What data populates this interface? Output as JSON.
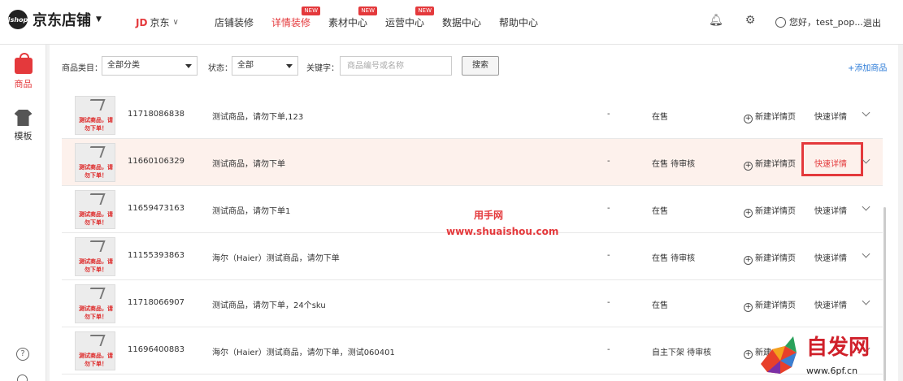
{
  "header": {
    "logo_badge": "Jshop",
    "logo_text": "京东店铺",
    "jd_mark": "JD",
    "jd_text": "京东",
    "nav": [
      {
        "label": "店铺装修",
        "active": false,
        "badge": ""
      },
      {
        "label": "详情装修",
        "active": true,
        "badge": "NEW"
      },
      {
        "label": "素材中心",
        "active": false,
        "badge": "NEW"
      },
      {
        "label": "运营中心",
        "active": false,
        "badge": "NEW"
      },
      {
        "label": "数据中心",
        "active": false,
        "badge": ""
      },
      {
        "label": "帮助中心",
        "active": false,
        "badge": ""
      }
    ],
    "greeting": "您好，test_pop...",
    "logout": "退出"
  },
  "sidebar": {
    "items": [
      {
        "label": "商品",
        "icon": "shopping-bag-icon",
        "active": true
      },
      {
        "label": "模板",
        "icon": "tshirt-icon",
        "active": false
      }
    ]
  },
  "filter": {
    "category_label": "商品类目：",
    "category_value": "全部分类",
    "status_label": "状态：",
    "status_value": "全部",
    "keyword_label": "关键字：",
    "keyword_placeholder": "商品编号或名称",
    "search_button": "搜索",
    "add_link": "+添加商品"
  },
  "thumb_text": "测试商品，请勿下单！",
  "rows": [
    {
      "id": "11718086838",
      "name": "测试商品，请勿下单,123",
      "dash": "-",
      "status": "在售",
      "new_label": "新建详情页",
      "quick_label": "快速详情",
      "highlight": false
    },
    {
      "id": "11660106329",
      "name": "测试商品，请勿下单",
      "dash": "-",
      "status": "在售 待审核",
      "new_label": "新建详情页",
      "quick_label": "快速详情",
      "highlight": true
    },
    {
      "id": "11659473163",
      "name": "测试商品，请勿下单1",
      "dash": "-",
      "status": "在售",
      "new_label": "新建详情页",
      "quick_label": "快速详情",
      "highlight": false
    },
    {
      "id": "11155393863",
      "name": "海尔（Haier）测试商品，请勿下单",
      "dash": "-",
      "status": "在售 待审核",
      "new_label": "新建详情页",
      "quick_label": "快速详情",
      "highlight": false
    },
    {
      "id": "11718066907",
      "name": "测试商品，请勿下单，24个sku",
      "dash": "-",
      "status": "在售",
      "new_label": "新建详情页",
      "quick_label": "快速详情",
      "highlight": false
    },
    {
      "id": "11696400883",
      "name": "海尔（Haier）测试商品，请勿下单，测试060401",
      "dash": "-",
      "status": "自主下架 待审核",
      "new_label": "新建",
      "quick_label": "",
      "highlight": false
    }
  ],
  "watermark": {
    "line1": "用手网",
    "line2": "www.shuaishou.com"
  },
  "brand": {
    "text": "自发网",
    "url": "www.6pf.cn"
  },
  "colors": {
    "accent": "#e4393c",
    "link": "#2a7ad7",
    "highlight_row": "#fdf1ec"
  }
}
